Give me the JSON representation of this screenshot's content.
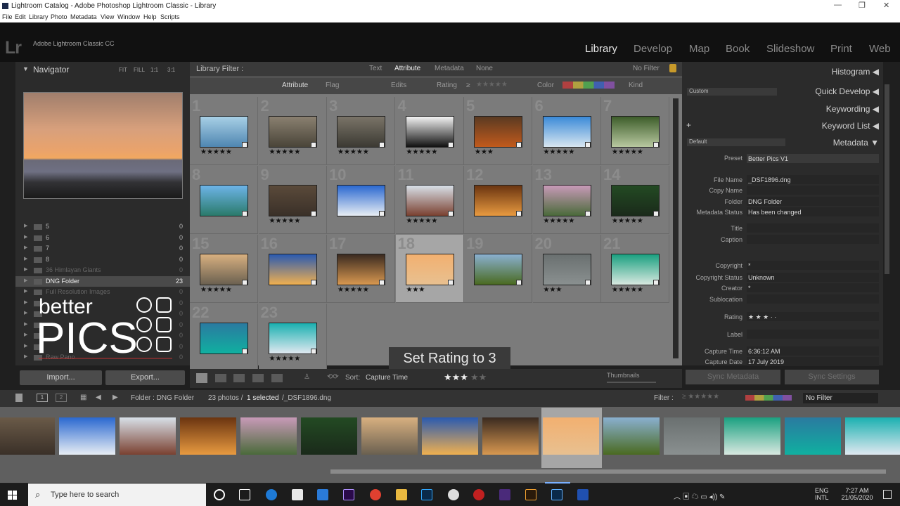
{
  "window": {
    "title": "Lightroom Catalog - Adobe Photoshop Lightroom Classic - Library"
  },
  "menu": [
    "File",
    "Edit",
    "Library",
    "Photo",
    "Metadata",
    "View",
    "Window",
    "Help",
    "Scripts"
  ],
  "header": {
    "logo": "Lr",
    "app_name": "Adobe Lightroom Classic CC"
  },
  "modules": [
    "Library",
    "Develop",
    "Map",
    "Book",
    "Slideshow",
    "Print",
    "Web"
  ],
  "navigator": {
    "title": "Navigator",
    "zoom": [
      "FIT",
      "FILL",
      "1:1",
      "3:1"
    ]
  },
  "folders": [
    {
      "label": "5",
      "count": "0"
    },
    {
      "label": "6",
      "count": "0"
    },
    {
      "label": "7",
      "count": "0"
    },
    {
      "label": "8",
      "count": "0"
    },
    {
      "label": "36 Himlayan Giants",
      "count": "0"
    },
    {
      "label": "DNG Folder",
      "count": "23"
    },
    {
      "label": "Full Resolution Images",
      "count": "0"
    },
    {
      "label": "",
      "count": "0"
    },
    {
      "label": "",
      "count": "0"
    },
    {
      "label": "",
      "count": "0"
    },
    {
      "label": "",
      "count": "0"
    },
    {
      "label": "",
      "count": "0"
    },
    {
      "label": "Raw Pano",
      "count": "0"
    }
  ],
  "left_buttons": {
    "import": "Import...",
    "export": "Export..."
  },
  "watermark": {
    "line1": "better",
    "line2": "PICS"
  },
  "library_filter": {
    "label": "Library Filter :",
    "tabs": [
      "Text",
      "Attribute",
      "Metadata",
      "None"
    ],
    "active_tab": "Attribute",
    "preset": "No Filter",
    "attribute_row": {
      "attribute": "Attribute",
      "flag": "Flag",
      "edits": "Edits",
      "rating": "Rating",
      "rating_op": "≥",
      "color": "Color",
      "kind": "Kind"
    }
  },
  "grid": [
    {
      "num": "1",
      "stars": "★★★★★",
      "c1": "#a8d0e6",
      "c2": "#4f86b1"
    },
    {
      "num": "2",
      "stars": "★★★★★",
      "c1": "#8a8070",
      "c2": "#4a4539"
    },
    {
      "num": "3",
      "stars": "★★★★★",
      "c1": "#7a7468",
      "c2": "#3c3a33"
    },
    {
      "num": "4",
      "stars": "★★★★★",
      "c1": "#f3f3f3",
      "c2": "#111111"
    },
    {
      "num": "5",
      "stars": "★★★",
      "c1": "#5a3a22",
      "c2": "#c25a1c"
    },
    {
      "num": "6",
      "stars": "★★★★★",
      "c1": "#3a8ad8",
      "c2": "#d8e6f0"
    },
    {
      "num": "7",
      "stars": "★★★★★",
      "c1": "#3d5d2a",
      "c2": "#b8c8a0"
    },
    {
      "num": "8",
      "stars": "",
      "c1": "#6db4e8",
      "c2": "#2a7a6a"
    },
    {
      "num": "9",
      "stars": "★★★★★",
      "c1": "#5a4a3a",
      "c2": "#3a3028"
    },
    {
      "num": "10",
      "stars": "",
      "c1": "#2a68d0",
      "c2": "#e8eef4"
    },
    {
      "num": "11",
      "stars": "★★★★★",
      "c1": "#d8e0e8",
      "c2": "#7a4030"
    },
    {
      "num": "12",
      "stars": "",
      "c1": "#6a3410",
      "c2": "#e89a40"
    },
    {
      "num": "13",
      "stars": "★★★★★",
      "c1": "#c89ab8",
      "c2": "#4a6a3a"
    },
    {
      "num": "14",
      "stars": "★★★★★",
      "c1": "#234a23",
      "c2": "#1a2a1a"
    },
    {
      "num": "15",
      "stars": "★★★★★",
      "c1": "#d8b080",
      "c2": "#6a6050"
    },
    {
      "num": "16",
      "stars": "",
      "c1": "#2a5ab0",
      "c2": "#f0b050"
    },
    {
      "num": "17",
      "stars": "★★★★★",
      "c1": "#3a2a20",
      "c2": "#d89850"
    },
    {
      "num": "18",
      "stars": "★★★",
      "c1": "#f2b070",
      "c2": "#e8c090"
    },
    {
      "num": "19",
      "stars": "",
      "c1": "#8ab0d0",
      "c2": "#4a6a20"
    },
    {
      "num": "20",
      "stars": "★★★",
      "c1": "#6a7070",
      "c2": "#8a9090"
    },
    {
      "num": "21",
      "stars": "★★★★★",
      "c1": "#1aa080",
      "c2": "#d8e8e0"
    },
    {
      "num": "22",
      "stars": "",
      "c1": "#2a7aa0",
      "c2": "#10b0a0"
    },
    {
      "num": "23",
      "stars": "★★★★★",
      "c1": "#1ab0b0",
      "c2": "#e0e8f0"
    }
  ],
  "toast": "Set Rating to 3",
  "toolbar": {
    "sort_label": "Sort:",
    "sort_value": "Capture Time",
    "rating_stars": "★★★",
    "rating_empty": "★★",
    "thumbs_label": "Thumbnails"
  },
  "right_panel": {
    "histogram": "Histogram",
    "quick_develop": "Quick Develop",
    "quick_develop_preset": "Custom",
    "keywording": "Keywording",
    "keyword_list": "Keyword List",
    "metadata": "Metadata",
    "metadata_preset": "Default",
    "preset_label": "Preset",
    "preset_value": "Better Pics V1",
    "fields": [
      {
        "label": "File Name",
        "value": "_DSF1896.dng"
      },
      {
        "label": "Copy Name",
        "value": ""
      },
      {
        "label": "Folder",
        "value": "DNG Folder"
      },
      {
        "label": "Metadata Status",
        "value": "Has been changed"
      },
      {
        "label": "Title",
        "value": ""
      },
      {
        "label": "Caption",
        "value": ""
      },
      {
        "label": "Copyright",
        "value": "*"
      },
      {
        "label": "Copyright Status",
        "value": "Unknown"
      },
      {
        "label": "Creator",
        "value": "*"
      },
      {
        "label": "Sublocation",
        "value": ""
      },
      {
        "label": "Rating",
        "value": "★ ★ ★   ·   ·"
      },
      {
        "label": "Label",
        "value": ""
      },
      {
        "label": "Capture Time",
        "value": "6:36:12 AM"
      },
      {
        "label": "Capture Date",
        "value": "17 July 2019"
      }
    ],
    "sync_metadata": "Sync Metadata",
    "sync_settings": "Sync Settings"
  },
  "filmstrip": {
    "page1": "1",
    "page2": "2",
    "source": "Folder : DNG Folder",
    "count_prefix": "23 photos /",
    "selected": "1 selected",
    "file": "/_DSF1896.dng",
    "filter_label": "Filter :",
    "filter_value": "No Filter",
    "thumbs": [
      {
        "c1": "#6a5a48",
        "c2": "#3a3028"
      },
      {
        "c1": "#2a68d0",
        "c2": "#e8eef4"
      },
      {
        "c1": "#d8e0e8",
        "c2": "#7a4030"
      },
      {
        "c1": "#6a3410",
        "c2": "#e89a40"
      },
      {
        "c1": "#c89ab8",
        "c2": "#4a6a3a"
      },
      {
        "c1": "#234a23",
        "c2": "#1a2a1a"
      },
      {
        "c1": "#d8b080",
        "c2": "#6a6050"
      },
      {
        "c1": "#2a5ab0",
        "c2": "#f0b050"
      },
      {
        "c1": "#3a2a20",
        "c2": "#d89850"
      },
      {
        "c1": "#f2b070",
        "c2": "#e8c090"
      },
      {
        "c1": "#8ab0d0",
        "c2": "#4a6a20"
      },
      {
        "c1": "#6a7070",
        "c2": "#8a9090"
      },
      {
        "c1": "#1aa080",
        "c2": "#d8e8e0"
      },
      {
        "c1": "#2a7aa0",
        "c2": "#10b0a0"
      },
      {
        "c1": "#1ab0b0",
        "c2": "#e0e8f0"
      }
    ]
  },
  "taskbar": {
    "search_placeholder": "Type here to search",
    "lang1": "ENG",
    "lang2": "INTL",
    "time": "7:27 AM",
    "date": "21/05/2020"
  }
}
